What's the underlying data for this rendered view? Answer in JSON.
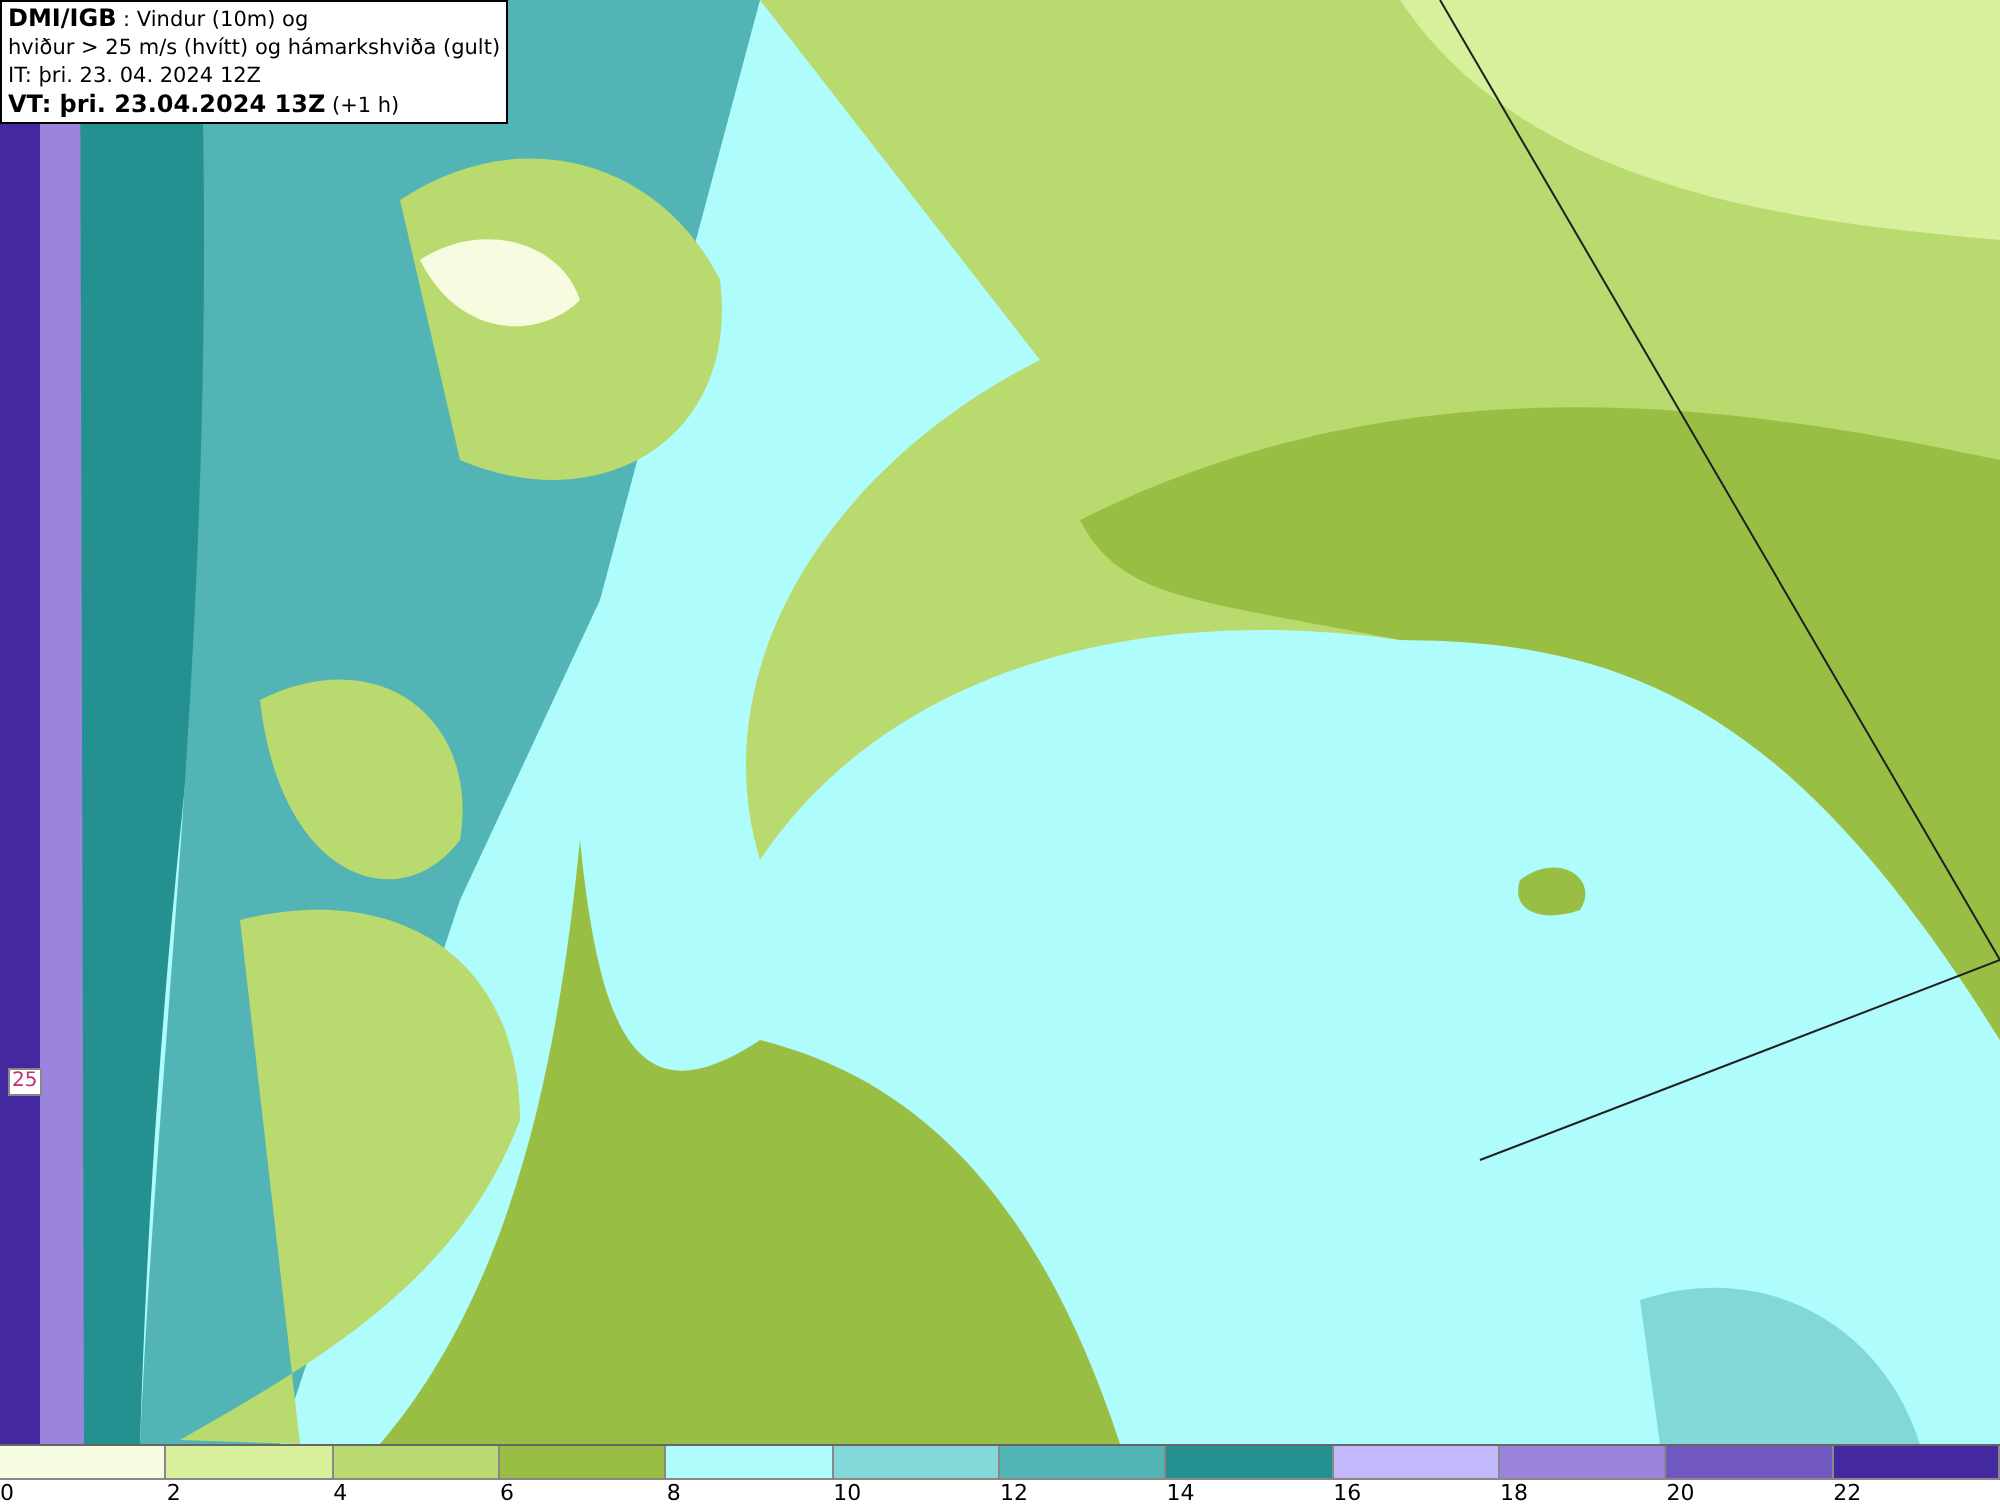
{
  "header": {
    "lines": [
      "**DMI/IGB** : Vindur (10m) og",
      "hviður > 25 m/s (hvítt) og hámarkshviða (gult)",
      "IT: þri. 23. 04. 2024 12Z",
      "**VT: þri. 23.04.2024 13Z** (+1 h)"
    ]
  },
  "map": {
    "contour_label": "25"
  },
  "legend": [
    {
      "label": "0",
      "color": "#f7fbe0"
    },
    {
      "label": "2",
      "color": "#d8ef9c"
    },
    {
      "label": "4",
      "color": "#b8da6e"
    },
    {
      "label": "6",
      "color": "#98bf44"
    },
    {
      "label": "8",
      "color": "#aefcfc"
    },
    {
      "label": "10",
      "color": "#82d8d8"
    },
    {
      "label": "12",
      "color": "#52b4b4"
    },
    {
      "label": "14",
      "color": "#249090"
    },
    {
      "label": "16",
      "color": "#c4b8fc"
    },
    {
      "label": "18",
      "color": "#9a84dc"
    },
    {
      "label": "20",
      "color": "#7058c0"
    },
    {
      "label": "22",
      "color": "#4428a0"
    }
  ]
}
